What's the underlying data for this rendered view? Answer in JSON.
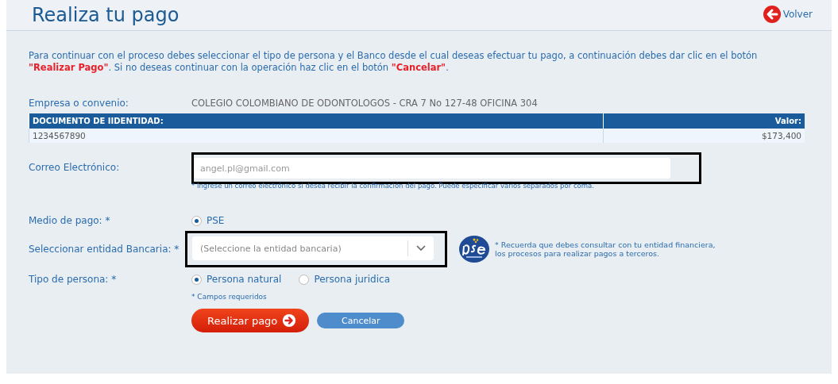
{
  "header": {
    "title": "Realiza tu pago",
    "back_link": "Volver"
  },
  "intro": "Para continuar con el proceso debes seleccionar el tipo de persona y el Banco desde el cual deseas efectuar tu pago, a continuación debes dar clic en el botón **\"Realizar Pago\"**. Si no deseas continuar con la operación haz clic en el botón **\"Cancelar\"**.",
  "company": {
    "label": "Empresa o convenio:",
    "value": "COLEGIO COLOMBIANO DE ODONTOLOGOS - CRA 7 No 127-48 OFICINA 304"
  },
  "table": {
    "columns": [
      "DOCUMENTO DE IIDENTIDAD:",
      "Valor:"
    ],
    "rows": [
      [
        "1234567890",
        "$173,400"
      ]
    ]
  },
  "email": {
    "label": "Correo Electrónico:",
    "placeholder": "angel.pl@gmail.com",
    "hint": "* Ingrese un correo electrónico si desea recibir la confirmación del pago. Puede especificar varios separados por coma."
  },
  "payment_method": {
    "label": "Medio de pago: *",
    "options": [
      {
        "label": "PSE",
        "selected": true
      }
    ]
  },
  "bank": {
    "label": "Seleccionar entidad Bancaria: *",
    "placeholder": "(Seleccione la entidad bancaria)",
    "note": "* Recuerda que debes consultar con tu entidad financiera,   los procesos para realizar pagos a terceros."
  },
  "person_type": {
    "label": "Tipo de persona: *",
    "options": [
      {
        "label": "Persona natural",
        "selected": true
      },
      {
        "label": "Persona juridica",
        "selected": false
      }
    ]
  },
  "required_note": "* Campos requeridos",
  "buttons": [
    {
      "label": "Realizar pago",
      "kind": "primary"
    },
    {
      "label": "Cancelar",
      "kind": "secondary"
    }
  ]
}
